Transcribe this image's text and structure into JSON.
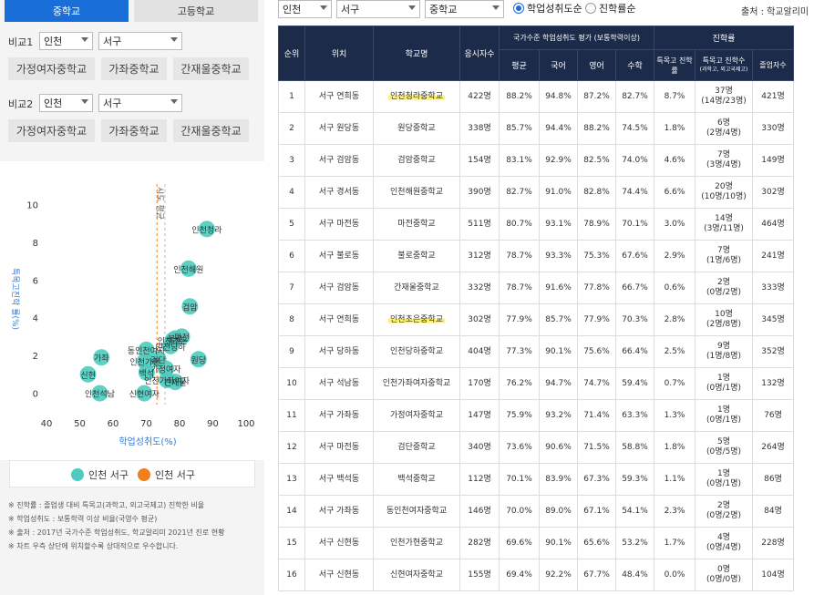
{
  "tabs": {
    "middle": "중학교",
    "high": "고등학교"
  },
  "compare1": {
    "label": "비교1",
    "region": "인천",
    "district": "서구",
    "chips": [
      "가정여자중학교",
      "가좌중학교",
      "간재울중학교"
    ]
  },
  "compare2": {
    "label": "비교2",
    "region": "인천",
    "district": "서구",
    "chips": [
      "가정여자중학교",
      "가좌중학교",
      "간재울중학교"
    ]
  },
  "chart_data": {
    "type": "scatter",
    "xlabel": "학업성취도(%)",
    "ylabel": "특목고진학 률(%)",
    "xticks": [
      40,
      50,
      60,
      70,
      80,
      90,
      100
    ],
    "yticks": [
      0,
      2,
      4,
      6,
      8,
      10
    ],
    "xlim": [
      40,
      100
    ],
    "ylim": [
      -0.6,
      10.6
    ],
    "avg_line_label": "시도 평균",
    "color": "#4ecbbe",
    "points": [
      {
        "x": 88.2,
        "y": 8.7,
        "label": "인천청라"
      },
      {
        "x": 82.7,
        "y": 6.6,
        "label": "인천해원"
      },
      {
        "x": 83.1,
        "y": 4.6,
        "label": "검암"
      },
      {
        "x": 85.7,
        "y": 1.8,
        "label": "원당"
      },
      {
        "x": 80.7,
        "y": 3.0,
        "label": "마전"
      },
      {
        "x": 78.7,
        "y": 2.9,
        "label": "불로"
      },
      {
        "x": 78.7,
        "y": 0.6,
        "label": "간재울"
      },
      {
        "x": 77.9,
        "y": 2.8,
        "label": "인천초은"
      },
      {
        "x": 77.3,
        "y": 2.5,
        "label": "인천당하"
      },
      {
        "x": 76.2,
        "y": 0.7,
        "label": "인천가좌여자"
      },
      {
        "x": 75.9,
        "y": 1.3,
        "label": "가정여자"
      },
      {
        "x": 73.6,
        "y": 1.8,
        "label": "검단"
      },
      {
        "x": 70.1,
        "y": 1.1,
        "label": "백석"
      },
      {
        "x": 70.0,
        "y": 2.3,
        "label": "동인천여자"
      },
      {
        "x": 69.6,
        "y": 1.7,
        "label": "인천가현"
      },
      {
        "x": 69.4,
        "y": 0.0,
        "label": "신현여자"
      },
      {
        "x": 56.5,
        "y": 1.9,
        "label": "가좌"
      },
      {
        "x": 52.5,
        "y": 1.0,
        "label": "신현"
      },
      {
        "x": 56.0,
        "y": 0.0,
        "label": "인천석남"
      }
    ],
    "legend": [
      {
        "name": "인천 서구",
        "color": "#4ecbbe"
      },
      {
        "name": "인천 서구",
        "color": "#f07f1c"
      }
    ]
  },
  "notes": [
    "※ 진학률 : 졸업생 대비 특목고(과학고, 외고국제고) 진학한 비율",
    "※ 학업성취도 : 보통학력 이상 비율(국영수 평균)",
    "※ 출처 : 2017년 국가수준 학업성취도, 학교알리미 2021년 진로 현황",
    "※ 차트 우측 상단에 위치할수록 상대적으로 우수합니다."
  ],
  "filters": {
    "region": "인천",
    "district": "서구",
    "level": "중학교",
    "sort_achievement": "학업성취도순",
    "sort_admission": "진학률순"
  },
  "source": "출처 : 학교알리미",
  "table": {
    "h_rank": "순위",
    "h_location": "위치",
    "h_school": "학교명",
    "h_applicants": "응시자수",
    "h_group_achieve": "국가수준 학업성취도 평가 (보통학력이상)",
    "h_avg": "평균",
    "h_kor": "국어",
    "h_eng": "영어",
    "h_math": "수학",
    "h_group_admission": "진학률",
    "h_rate": "특목고 진학률",
    "h_count": "특목고 진학수",
    "h_count_sub": "(과학고, 외고국제고)",
    "h_grads": "졸업자수",
    "rows": [
      {
        "rank": "1",
        "loc": "서구 연희동",
        "school": "인천청라중학교",
        "n": "422명",
        "avg": "88.2%",
        "kor": "94.8%",
        "eng": "87.2%",
        "math": "82.7%",
        "rate": "8.7%",
        "cnt": "37명",
        "cnt2": "(14명/23명)",
        "grads": "421명",
        "hl": true
      },
      {
        "rank": "2",
        "loc": "서구 원당동",
        "school": "원당중학교",
        "n": "338명",
        "avg": "85.7%",
        "kor": "94.4%",
        "eng": "88.2%",
        "math": "74.5%",
        "rate": "1.8%",
        "cnt": "6명",
        "cnt2": "(2명/4명)",
        "grads": "330명",
        "hl": false
      },
      {
        "rank": "3",
        "loc": "서구 검암동",
        "school": "검암중학교",
        "n": "154명",
        "avg": "83.1%",
        "kor": "92.9%",
        "eng": "82.5%",
        "math": "74.0%",
        "rate": "4.6%",
        "cnt": "7명",
        "cnt2": "(3명/4명)",
        "grads": "149명",
        "hl": false
      },
      {
        "rank": "4",
        "loc": "서구 경서동",
        "school": "인천해원중학교",
        "n": "390명",
        "avg": "82.7%",
        "kor": "91.0%",
        "eng": "82.8%",
        "math": "74.4%",
        "rate": "6.6%",
        "cnt": "20명",
        "cnt2": "(10명/10명)",
        "grads": "302명",
        "hl": false
      },
      {
        "rank": "5",
        "loc": "서구 마전동",
        "school": "마전중학교",
        "n": "511명",
        "avg": "80.7%",
        "kor": "93.1%",
        "eng": "78.9%",
        "math": "70.1%",
        "rate": "3.0%",
        "cnt": "14명",
        "cnt2": "(3명/11명)",
        "grads": "464명",
        "hl": false
      },
      {
        "rank": "6",
        "loc": "서구 불로동",
        "school": "불로중학교",
        "n": "312명",
        "avg": "78.7%",
        "kor": "93.3%",
        "eng": "75.3%",
        "math": "67.6%",
        "rate": "2.9%",
        "cnt": "7명",
        "cnt2": "(1명/6명)",
        "grads": "241명",
        "hl": false
      },
      {
        "rank": "7",
        "loc": "서구 검암동",
        "school": "간재울중학교",
        "n": "332명",
        "avg": "78.7%",
        "kor": "91.6%",
        "eng": "77.8%",
        "math": "66.7%",
        "rate": "0.6%",
        "cnt": "2명",
        "cnt2": "(0명/2명)",
        "grads": "333명",
        "hl": false
      },
      {
        "rank": "8",
        "loc": "서구 연희동",
        "school": "인천초은중학교",
        "n": "302명",
        "avg": "77.9%",
        "kor": "85.7%",
        "eng": "77.9%",
        "math": "70.3%",
        "rate": "2.8%",
        "cnt": "10명",
        "cnt2": "(2명/8명)",
        "grads": "345명",
        "hl": true
      },
      {
        "rank": "9",
        "loc": "서구 당하동",
        "school": "인천당하중학교",
        "n": "404명",
        "avg": "77.3%",
        "kor": "90.1%",
        "eng": "75.6%",
        "math": "66.4%",
        "rate": "2.5%",
        "cnt": "9명",
        "cnt2": "(1명/8명)",
        "grads": "352명",
        "hl": false
      },
      {
        "rank": "10",
        "loc": "서구 석남동",
        "school": "인천가좌여자중학교",
        "n": "170명",
        "avg": "76.2%",
        "kor": "94.7%",
        "eng": "74.7%",
        "math": "59.4%",
        "rate": "0.7%",
        "cnt": "1명",
        "cnt2": "(0명/1명)",
        "grads": "132명",
        "hl": false
      },
      {
        "rank": "11",
        "loc": "서구 가좌동",
        "school": "가정여자중학교",
        "n": "147명",
        "avg": "75.9%",
        "kor": "93.2%",
        "eng": "71.4%",
        "math": "63.3%",
        "rate": "1.3%",
        "cnt": "1명",
        "cnt2": "(0명/1명)",
        "grads": "76명",
        "hl": false
      },
      {
        "rank": "12",
        "loc": "서구 마전동",
        "school": "검단중학교",
        "n": "340명",
        "avg": "73.6%",
        "kor": "90.6%",
        "eng": "71.5%",
        "math": "58.8%",
        "rate": "1.8%",
        "cnt": "5명",
        "cnt2": "(0명/5명)",
        "grads": "264명",
        "hl": false
      },
      {
        "rank": "13",
        "loc": "서구 백석동",
        "school": "백석중학교",
        "n": "112명",
        "avg": "70.1%",
        "kor": "83.9%",
        "eng": "67.3%",
        "math": "59.3%",
        "rate": "1.1%",
        "cnt": "1명",
        "cnt2": "(0명/1명)",
        "grads": "86명",
        "hl": false
      },
      {
        "rank": "14",
        "loc": "서구 가좌동",
        "school": "동인천여자중학교",
        "n": "146명",
        "avg": "70.0%",
        "kor": "89.0%",
        "eng": "67.1%",
        "math": "54.1%",
        "rate": "2.3%",
        "cnt": "2명",
        "cnt2": "(0명/2명)",
        "grads": "84명",
        "hl": false
      },
      {
        "rank": "15",
        "loc": "서구 신현동",
        "school": "인천가현중학교",
        "n": "282명",
        "avg": "69.6%",
        "kor": "90.1%",
        "eng": "65.6%",
        "math": "53.2%",
        "rate": "1.7%",
        "cnt": "4명",
        "cnt2": "(0명/4명)",
        "grads": "228명",
        "hl": false
      },
      {
        "rank": "16",
        "loc": "서구 신현동",
        "school": "신현여자중학교",
        "n": "155명",
        "avg": "69.4%",
        "kor": "92.2%",
        "eng": "67.7%",
        "math": "48.4%",
        "rate": "0.0%",
        "cnt": "0명",
        "cnt2": "(0명/0명)",
        "grads": "104명",
        "hl": false
      }
    ]
  }
}
